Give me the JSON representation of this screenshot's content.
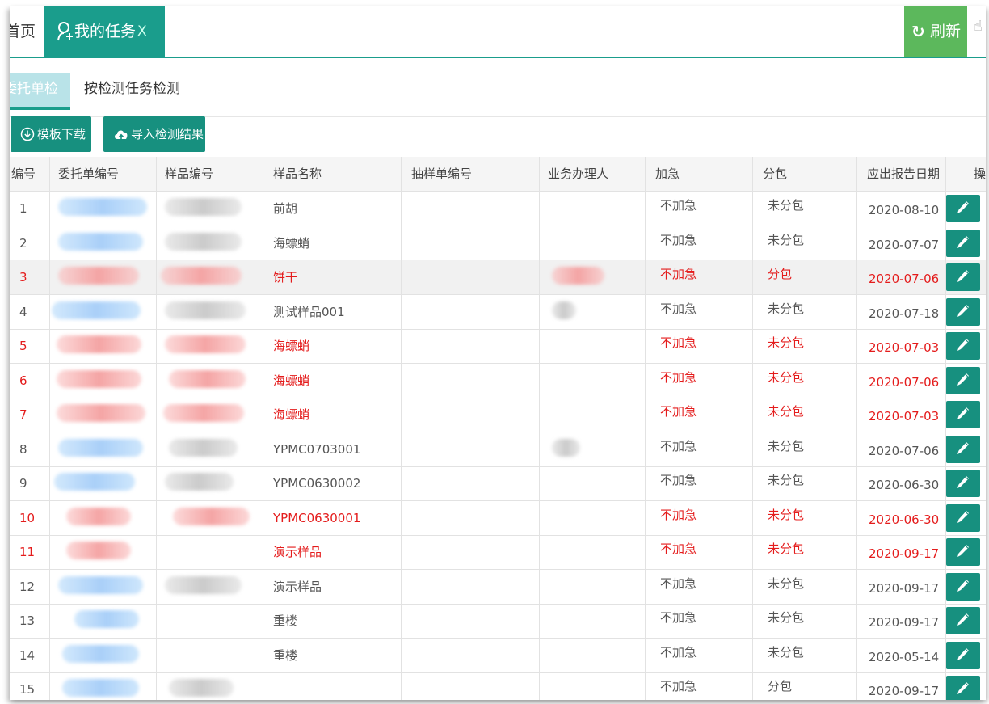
{
  "tabs": {
    "home": "首页",
    "active": "我的任务",
    "close": "X",
    "refresh": "刷新"
  },
  "subtabs": {
    "active": "委托单检测",
    "other": "按检测任务检测"
  },
  "toolbar": {
    "download": "模板下载",
    "import": "导入检测结果"
  },
  "table": {
    "headers": [
      "编号",
      "委托单编号",
      "样品编号",
      "样品名称",
      "抽样单编号",
      "业务办理人",
      "加急",
      "分包",
      "应出报告日期",
      "操作"
    ],
    "rows": [
      {
        "no": "1",
        "name": "前胡",
        "urgent": "不加急",
        "sub": "未分包",
        "date": "2020-08-10",
        "red": false
      },
      {
        "no": "2",
        "name": "海螵蛸",
        "urgent": "不加急",
        "sub": "未分包",
        "date": "2020-07-07",
        "red": false
      },
      {
        "no": "3",
        "name": "饼干",
        "urgent": "不加急",
        "sub": "分包",
        "date": "2020-07-06",
        "red": true
      },
      {
        "no": "4",
        "name": "测试样品001",
        "urgent": "不加急",
        "sub": "未分包",
        "date": "2020-07-18",
        "red": false
      },
      {
        "no": "5",
        "name": "海螵蛸",
        "urgent": "不加急",
        "sub": "未分包",
        "date": "2020-07-03",
        "red": true
      },
      {
        "no": "6",
        "name": "海螵蛸",
        "urgent": "不加急",
        "sub": "未分包",
        "date": "2020-07-06",
        "red": true
      },
      {
        "no": "7",
        "name": "海螵蛸",
        "urgent": "不加急",
        "sub": "未分包",
        "date": "2020-07-03",
        "red": true
      },
      {
        "no": "8",
        "name": "YPMC0703001",
        "urgent": "不加急",
        "sub": "未分包",
        "date": "2020-07-06",
        "red": false
      },
      {
        "no": "9",
        "name": "YPMC0630002",
        "urgent": "不加急",
        "sub": "未分包",
        "date": "2020-06-30",
        "red": false
      },
      {
        "no": "10",
        "name": "YPMC0630001",
        "urgent": "不加急",
        "sub": "未分包",
        "date": "2020-06-30",
        "red": true
      },
      {
        "no": "11",
        "name": "演示样品",
        "urgent": "不加急",
        "sub": "未分包",
        "date": "2020-09-17",
        "red": true
      },
      {
        "no": "12",
        "name": "演示样品",
        "urgent": "不加急",
        "sub": "未分包",
        "date": "2020-09-17",
        "red": false
      },
      {
        "no": "13",
        "name": "重楼",
        "urgent": "不加急",
        "sub": "未分包",
        "date": "2020-09-17",
        "red": false
      },
      {
        "no": "14",
        "name": "重楼",
        "urgent": "不加急",
        "sub": "未分包",
        "date": "2020-05-14",
        "red": false
      },
      {
        "no": "15",
        "name": "",
        "urgent": "不加急",
        "sub": "分包",
        "date": "2020-09-17",
        "red": false
      }
    ]
  },
  "colors": {
    "primary": "#1a9d8c",
    "button": "#17907f",
    "refresh": "#5cb85c",
    "danger_text": "#e41c1c",
    "link": "#1e90ff"
  }
}
